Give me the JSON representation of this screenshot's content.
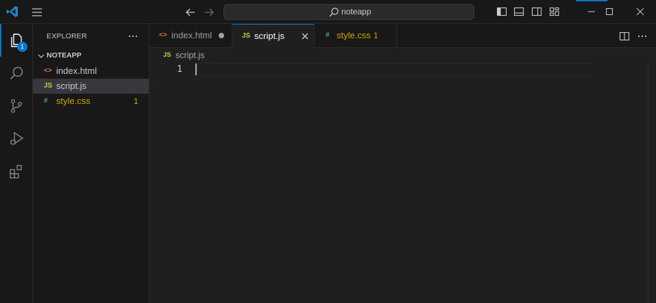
{
  "titlebar": {
    "search_text": "noteapp",
    "accent": "#0078d4"
  },
  "activity": {
    "explorer_badge": "1",
    "items": [
      "explorer",
      "search",
      "source-control",
      "run-and-debug",
      "extensions"
    ]
  },
  "sidebar": {
    "title": "EXPLORER",
    "folder": "NOTEAPP",
    "files": [
      {
        "icon": "<>",
        "name": "index.html",
        "color": "#cccccc",
        "icon_color": "#e37933"
      },
      {
        "icon": "JS",
        "name": "script.js",
        "color": "#cccccc",
        "icon_color": "#cbcb41"
      },
      {
        "icon": "#",
        "name": "style.css",
        "color": "#cca700",
        "icon_color": "#519aba",
        "badge": "1"
      }
    ]
  },
  "tabs": [
    {
      "icon": "<>",
      "label": "index.html",
      "modified": true
    },
    {
      "icon": "JS",
      "label": "script.js",
      "active": true
    },
    {
      "icon": "#",
      "label": "style.css",
      "badge": "1"
    }
  ],
  "breadcrumb": {
    "icon": "JS",
    "file": "script.js"
  },
  "editor": {
    "line_numbers": [
      "1"
    ]
  }
}
